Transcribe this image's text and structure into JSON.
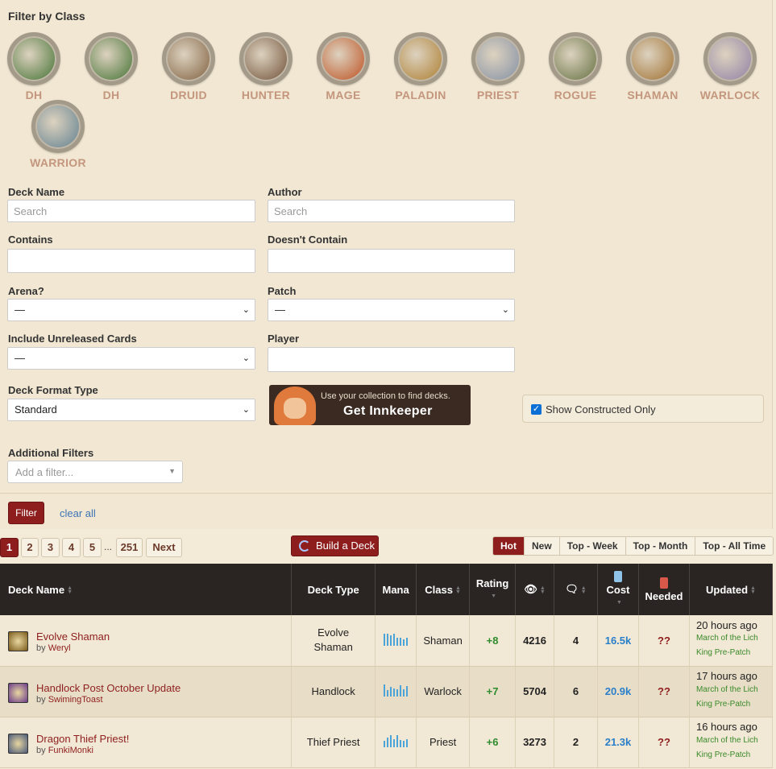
{
  "filter_title": "Filter by Class",
  "classes": [
    {
      "label": "DH",
      "icon": "demon-hunter-icon",
      "color": "#3c6b2c"
    },
    {
      "label": "DH",
      "icon": "demon-hunter-icon",
      "color": "#3c6b2c"
    },
    {
      "label": "DRUID",
      "icon": "druid-icon",
      "color": "#7a5a3a"
    },
    {
      "label": "HUNTER",
      "icon": "hunter-icon",
      "color": "#6a4a32"
    },
    {
      "label": "MAGE",
      "icon": "mage-icon",
      "color": "#b84a1a"
    },
    {
      "label": "PALADIN",
      "icon": "paladin-icon",
      "color": "#a7782a"
    },
    {
      "label": "PRIEST",
      "icon": "priest-icon",
      "color": "#7d8aa0"
    },
    {
      "label": "ROGUE",
      "icon": "rogue-icon",
      "color": "#5d6a3a"
    },
    {
      "label": "SHAMAN",
      "icon": "shaman-icon",
      "color": "#9a6a2a"
    },
    {
      "label": "WARLOCK",
      "icon": "warlock-icon",
      "color": "#8a7aa0"
    },
    {
      "label": "WARRIOR",
      "icon": "warrior-icon",
      "color": "#5a7a8a"
    }
  ],
  "form": {
    "deck_name_label": "Deck Name",
    "deck_name_placeholder": "Search",
    "author_label": "Author",
    "author_placeholder": "Search",
    "contains_label": "Contains",
    "doesnt_contain_label": "Doesn't Contain",
    "arena_label": "Arena?",
    "arena_value": "—",
    "patch_label": "Patch",
    "patch_value": "—",
    "unreleased_label": "Include Unreleased Cards",
    "unreleased_value": "—",
    "player_label": "Player",
    "format_label": "Deck Format Type",
    "format_value": "Standard",
    "innkeeper_small": "Use your collection to find decks.",
    "innkeeper_big": "Get Innkeeper",
    "constructed_label": "Show Constructed Only",
    "constructed_checked": true,
    "additional_label": "Additional Filters",
    "additional_placeholder": "Add a filter...",
    "filter_button": "Filter",
    "clear_all": "clear all"
  },
  "pagination": {
    "pages": [
      "1",
      "2",
      "3",
      "4",
      "5"
    ],
    "ellipsis": "...",
    "last": "251",
    "next": "Next",
    "active": "1"
  },
  "build_deck": "Build a Deck",
  "sort_tabs": [
    "Hot",
    "New",
    "Top - Week",
    "Top - Month",
    "Top - All Time"
  ],
  "active_tab": "Hot",
  "table": {
    "headers": {
      "deck_name": "Deck Name",
      "deck_type": "Deck Type",
      "mana": "Mana",
      "class": "Class",
      "rating": "Rating",
      "views_icon": "eye-icon",
      "comments_icon": "comment-icon",
      "cost": "Cost",
      "needed": "Needed",
      "updated": "Updated"
    },
    "rows": [
      {
        "icon": "shaman-icon",
        "icon_color": "#7a5a1a",
        "name": "Evolve Shaman",
        "by": "by",
        "author": "Weryl",
        "type": "Evolve Shaman",
        "class": "Shaman",
        "rating": "+8",
        "views": "4216",
        "comments": "4",
        "cost": "16.5k",
        "needed": "??",
        "updated": "20 hours ago",
        "patch": "March of the Lich King Pre-Patch",
        "mana_curve": [
          0.95,
          0.95,
          0.8,
          0.95,
          0.6,
          0.6,
          0.5,
          0.6
        ]
      },
      {
        "icon": "warlock-icon",
        "icon_color": "#6a3a8a",
        "name": "Handlock Post October Update",
        "by": "by",
        "author": "SwimingToast",
        "type": "Handlock",
        "class": "Warlock",
        "rating": "+7",
        "views": "5704",
        "comments": "6",
        "cost": "20.9k",
        "needed": "??",
        "updated": "17 hours ago",
        "patch": "March of the Lich King Pre-Patch",
        "mana_curve": [
          0.95,
          0.5,
          0.75,
          0.6,
          0.55,
          0.9,
          0.55,
          0.8
        ]
      },
      {
        "icon": "priest-icon",
        "icon_color": "#4a5a7a",
        "name": "Dragon Thief Priest!",
        "by": "by",
        "author": "FunkiMonki",
        "type": "Thief Priest",
        "class": "Priest",
        "rating": "+6",
        "views": "3273",
        "comments": "2",
        "cost": "21.3k",
        "needed": "??",
        "updated": "16 hours ago",
        "patch": "March of the Lich King Pre-Patch",
        "mana_curve": [
          0.5,
          0.75,
          0.95,
          0.6,
          0.95,
          0.55,
          0.5,
          0.6
        ]
      }
    ]
  }
}
